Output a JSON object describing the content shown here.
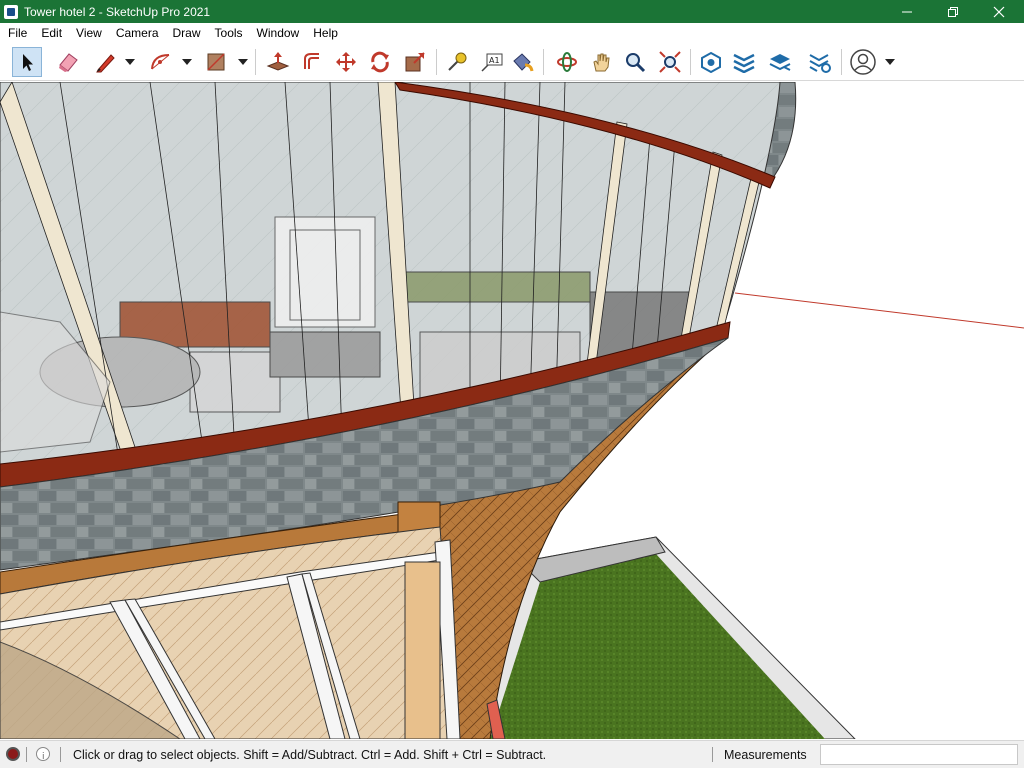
{
  "window": {
    "title": "Tower hotel 2 - SketchUp Pro 2021",
    "minimize": "—",
    "maximize": "❐",
    "close": "✕"
  },
  "menu": [
    "File",
    "Edit",
    "View",
    "Camera",
    "Draw",
    "Tools",
    "Window",
    "Help"
  ],
  "toolbar": {
    "tools": [
      {
        "name": "select-tool",
        "icon": "arrow-icon",
        "active": true
      },
      {
        "name": "eraser-tool",
        "icon": "eraser-icon"
      },
      {
        "name": "line-tool",
        "icon": "pencil-icon"
      },
      {
        "name": "arc-tool",
        "icon": "arc-icon"
      },
      {
        "name": "rectangle-tool",
        "icon": "rectangle-icon"
      },
      {
        "name": "push-pull-tool",
        "icon": "push-pull-icon"
      },
      {
        "name": "offset-tool",
        "icon": "offset-icon"
      },
      {
        "name": "move-tool",
        "icon": "move-icon"
      },
      {
        "name": "rotate-tool",
        "icon": "rotate-icon"
      },
      {
        "name": "scale-tool",
        "icon": "scale-icon"
      },
      {
        "name": "tape-measure-tool",
        "icon": "tape-measure-icon"
      },
      {
        "name": "text-tool",
        "icon": "text-icon",
        "glyph": "A1"
      },
      {
        "name": "paint-bucket-tool",
        "icon": "paint-bucket-icon"
      },
      {
        "name": "orbit-tool",
        "icon": "orbit-icon"
      },
      {
        "name": "pan-tool",
        "icon": "hand-icon"
      },
      {
        "name": "zoom-tool",
        "icon": "magnifier-icon"
      },
      {
        "name": "zoom-extents-tool",
        "icon": "zoom-extents-icon"
      },
      {
        "name": "warehouse-button",
        "icon": "warehouse-icon"
      },
      {
        "name": "extension-warehouse-button",
        "icon": "extension-warehouse-icon"
      },
      {
        "name": "layout-button",
        "icon": "layout-icon"
      },
      {
        "name": "extension-manager-button",
        "icon": "extension-manager-icon"
      },
      {
        "name": "account-button",
        "icon": "user-icon"
      }
    ]
  },
  "status": {
    "hint": "Click or drag to select objects. Shift = Add/Subtract. Ctrl = Add. Shift + Ctrl = Subtract.",
    "measurements_label": "Measurements",
    "measurements_value": ""
  },
  "colors": {
    "titlebar": "#1b7436",
    "brick_frame": "#8b2a14",
    "glass": "#c9d2d4",
    "stone": "#7b8486",
    "wood": "#b9793a",
    "grass": "#4f7a22",
    "red_axis": "#c0392b"
  }
}
